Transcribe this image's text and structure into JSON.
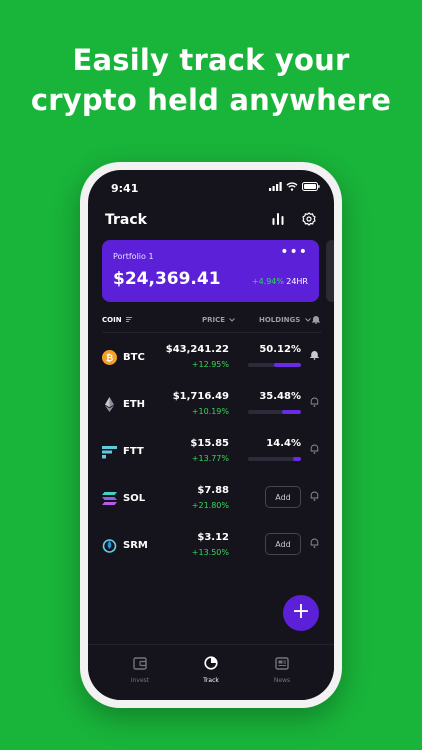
{
  "headline": {
    "line1": "Easily track your",
    "line2": "crypto held anywhere"
  },
  "status_bar": {
    "time": "9:41"
  },
  "header": {
    "title": "Track"
  },
  "portfolio": {
    "name": "Portfolio 1",
    "menu": "•••",
    "value": "$24,369.41",
    "change": "+4.94%",
    "period": "24HR"
  },
  "columns": {
    "coin": "COIN",
    "price": "PRICE",
    "holdings": "HOLDINGS"
  },
  "coins": [
    {
      "symbol": "BTC",
      "price": "$43,241.22",
      "change": "+12.95%",
      "holdings": "50.12%",
      "holdings_fraction": 0.5012,
      "icon": "bitcoin-icon"
    },
    {
      "symbol": "ETH",
      "price": "$1,716.49",
      "change": "+10.19%",
      "holdings": "35.48%",
      "holdings_fraction": 0.3548,
      "icon": "ethereum-icon"
    },
    {
      "symbol": "FTT",
      "price": "$15.85",
      "change": "+13.77%",
      "holdings": "14.4%",
      "holdings_fraction": 0.144,
      "icon": "ftx-token-icon"
    },
    {
      "symbol": "SOL",
      "price": "$7.88",
      "change": "+21.80%",
      "add_label": "Add",
      "icon": "solana-icon"
    },
    {
      "symbol": "SRM",
      "price": "$3.12",
      "change": "+13.50%",
      "add_label": "Add",
      "icon": "serum-icon"
    }
  ],
  "fab": {
    "label": "+"
  },
  "tabs": [
    {
      "label": "Invest",
      "icon": "wallet-icon",
      "active": false
    },
    {
      "label": "Track",
      "icon": "track-icon",
      "active": true
    },
    {
      "label": "News",
      "icon": "newspaper-icon",
      "active": false
    }
  ],
  "colors": {
    "background": "#19b43a",
    "accent": "#5b20d8",
    "positive": "#36d75a",
    "screen": "#15141c"
  }
}
